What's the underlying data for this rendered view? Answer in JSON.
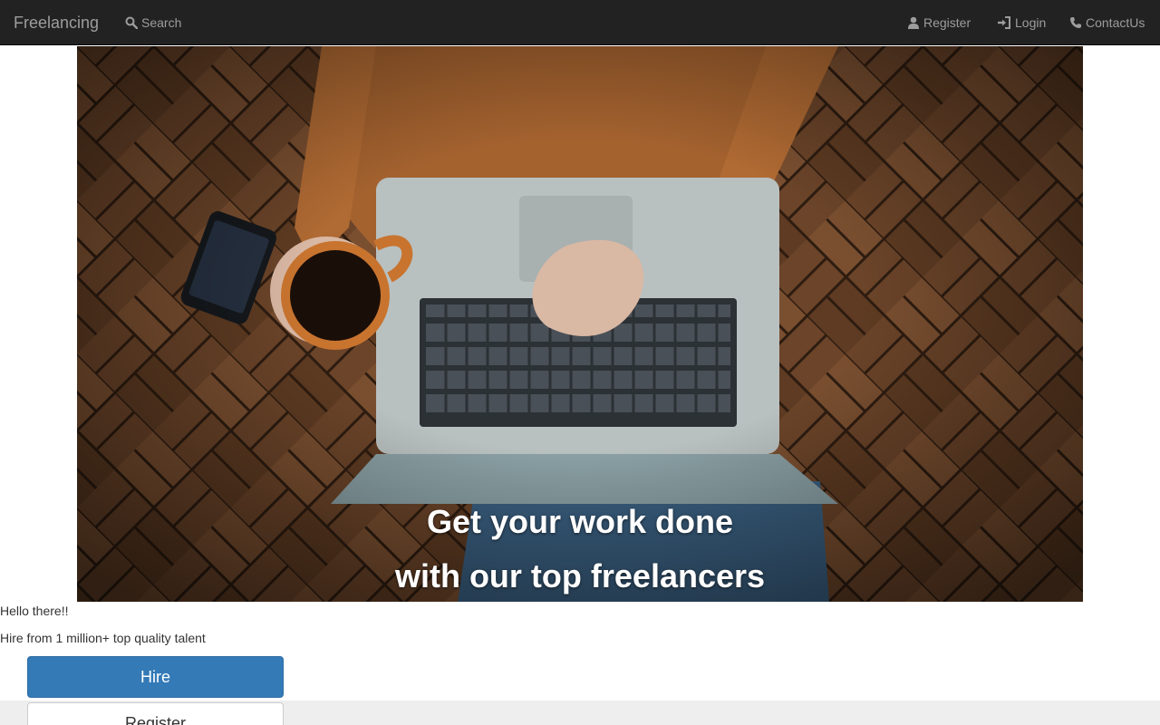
{
  "navbar": {
    "brand": "Freelancing",
    "search_label": "Search",
    "register_label": "Register",
    "login_label": "Login",
    "contact_label": "ContactUs"
  },
  "hero": {
    "caption_line1": "Get your work done",
    "caption_line2": "with our top freelancers"
  },
  "intro": {
    "greeting": "Hello there!!",
    "tagline": "Hire from 1 million+ top quality talent"
  },
  "actions": {
    "hire_label": "Hire",
    "register_label": "Register"
  },
  "icons": {
    "search": "search-icon",
    "register": "user-icon",
    "login": "log-in-icon",
    "contact": "phone-icon"
  },
  "colors": {
    "navbar_bg": "#222222",
    "nav_text": "#9d9d9d",
    "primary": "#337ab7"
  }
}
